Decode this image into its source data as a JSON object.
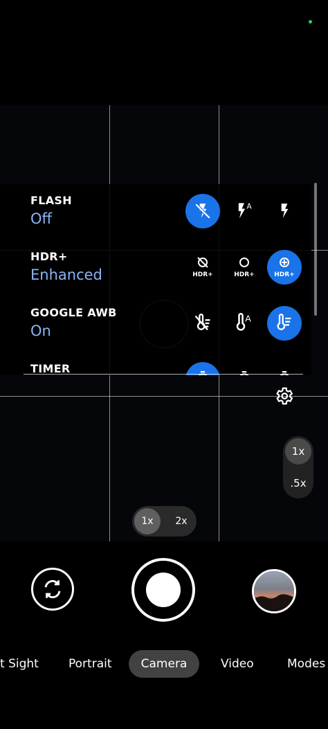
{
  "status": {
    "indicator_color": "#1ed760"
  },
  "settings": {
    "rows": [
      {
        "title": "FLASH",
        "value": "Off"
      },
      {
        "title": "HDR+",
        "value": "Enhanced"
      },
      {
        "title": "GOOGLE AWB",
        "value": "On"
      },
      {
        "title": "TIMER",
        "value": ""
      }
    ],
    "flash_options": [
      {
        "icon": "flash-off-icon",
        "selected": true
      },
      {
        "icon": "flash-auto-icon",
        "selected": false
      },
      {
        "icon": "flash-on-icon",
        "selected": false
      }
    ],
    "hdr_options": [
      {
        "icon": "hdr-off-icon",
        "label": "HDR+",
        "selected": false
      },
      {
        "icon": "hdr-on-icon",
        "label": "HDR+",
        "selected": false
      },
      {
        "icon": "hdr-enhanced-icon",
        "label": "HDR+",
        "selected": true
      }
    ],
    "awb_options": [
      {
        "icon": "awb-off-icon",
        "selected": false
      },
      {
        "icon": "awb-auto-icon",
        "selected": false
      },
      {
        "icon": "awb-on-icon",
        "selected": true
      }
    ],
    "accent_color": "#1a73e8",
    "value_color": "#8ab4f8",
    "flash_auto_letter": "A",
    "awb_auto_letter": "A"
  },
  "lens": {
    "options": [
      "1x",
      ".5x"
    ],
    "selected": "1x"
  },
  "zoom": {
    "options": [
      "1x",
      "2x"
    ],
    "selected": "1x"
  },
  "modes": {
    "items": [
      "t Sight",
      "Portrait",
      "Camera",
      "Video",
      "Modes"
    ],
    "selected": "Camera"
  }
}
